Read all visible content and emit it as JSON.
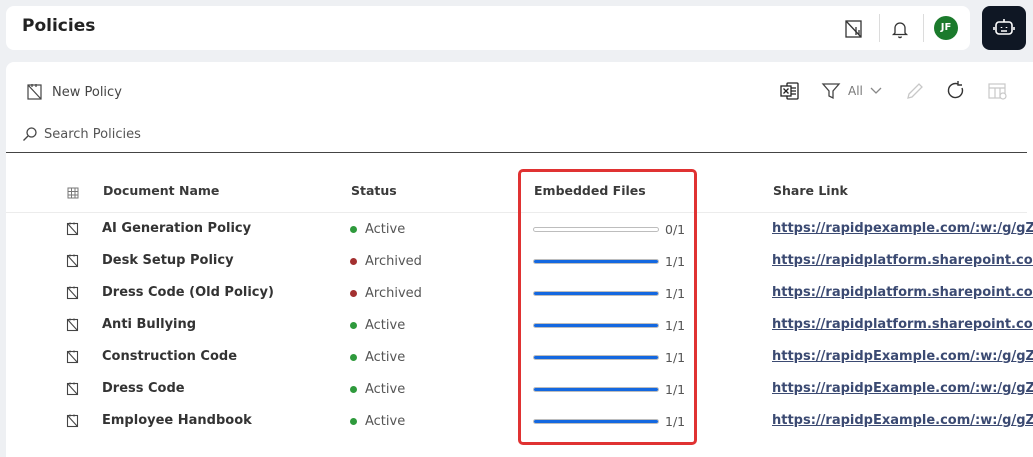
{
  "header": {
    "title": "Policies",
    "avatar_initials": "JF",
    "icons": [
      "reports-icon",
      "bell-icon",
      "ai-bot-icon"
    ]
  },
  "toolbar": {
    "new_policy_label": "New Policy",
    "filter_label": "All",
    "icons": [
      "excel-export-icon",
      "filter-icon",
      "chevron-down-icon",
      "pencil-icon",
      "refresh-icon",
      "column-settings-icon"
    ]
  },
  "search": {
    "placeholder": "Search Policies"
  },
  "table": {
    "headers": {
      "name": "Document Name",
      "status": "Status",
      "files": "Embedded Files",
      "link": "Share Link"
    },
    "rows": [
      {
        "name": "AI Generation Policy",
        "status": "Active",
        "files": "0/1",
        "progress": 0,
        "link": "https://rapidpexample.com/:w:/g/gZoxv"
      },
      {
        "name": "Desk Setup Policy",
        "status": "Archived",
        "files": "1/1",
        "progress": 1,
        "link": "https://rapidplatform.sharepoint.com/:"
      },
      {
        "name": "Dress Code (Old Policy)",
        "status": "Archived",
        "files": "1/1",
        "progress": 1,
        "link": "https://rapidplatform.sharepoint.com/:"
      },
      {
        "name": "Anti Bullying",
        "status": "Active",
        "files": "1/1",
        "progress": 1,
        "link": "https://rapidplatform.sharepoint.com/:"
      },
      {
        "name": "Construction Code",
        "status": "Active",
        "files": "1/1",
        "progress": 1,
        "link": "https://rapidpExample.com/:w:/g/gZoxv"
      },
      {
        "name": "Dress Code",
        "status": "Active",
        "files": "1/1",
        "progress": 1,
        "link": "https://rapidpExample.com/:w:/g/gZoxv"
      },
      {
        "name": "Employee Handbook",
        "status": "Active",
        "files": "1/1",
        "progress": 1,
        "link": "https://rapidpExample.com/:w:/g/gZoxv"
      }
    ]
  },
  "colors": {
    "active": "#2e9a3c",
    "archived": "#a33030",
    "progress": "#1468e0",
    "highlight": "#e03232",
    "avatar": "#1b7a2c"
  }
}
